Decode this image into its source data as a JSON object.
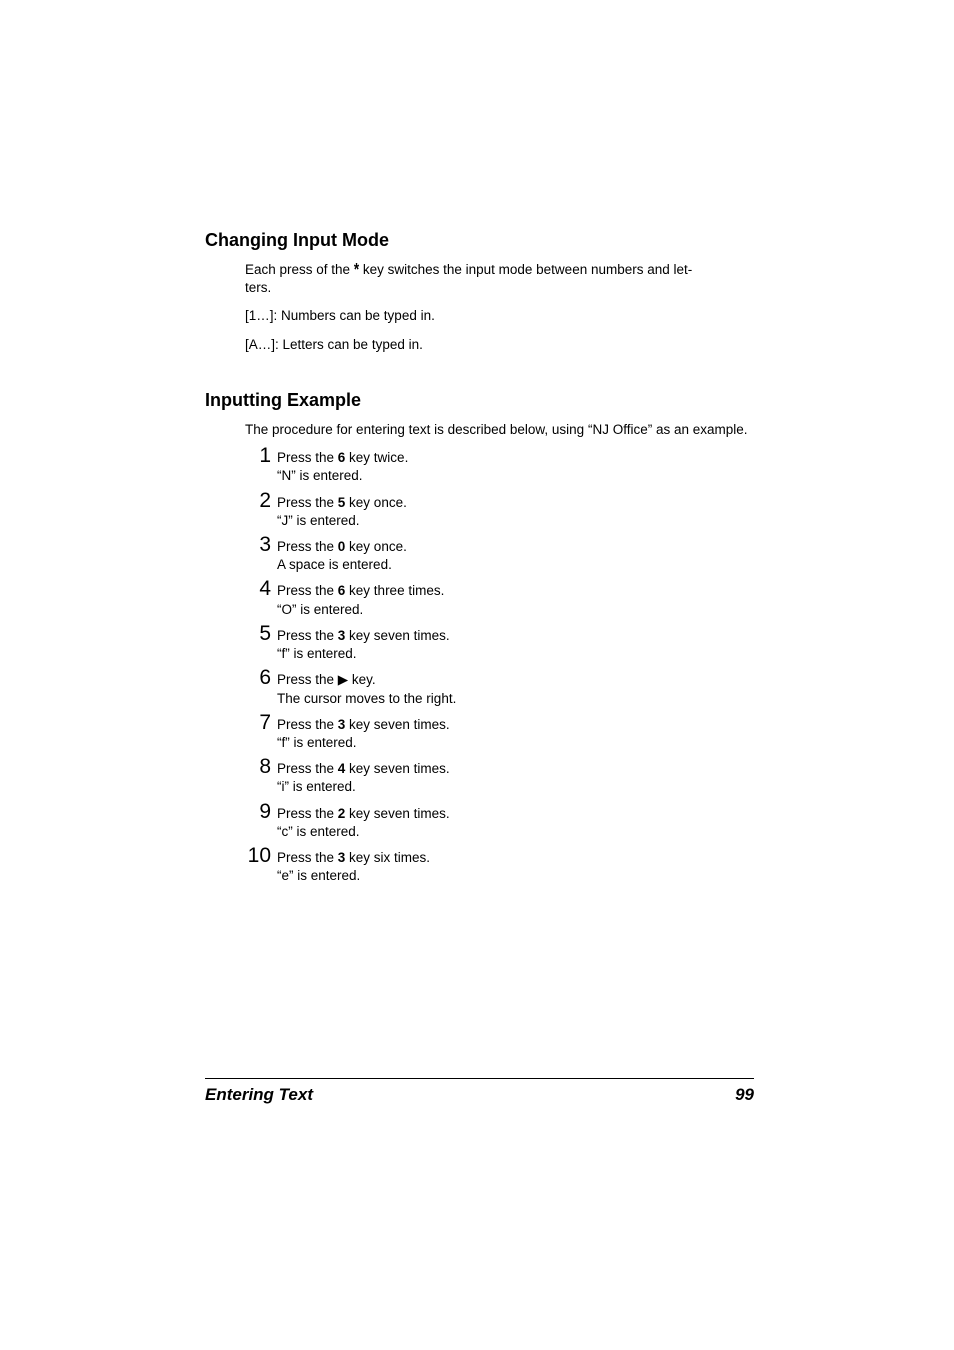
{
  "section1": {
    "heading": "Changing Input Mode",
    "p1_a": "Each press of the ",
    "star": "*",
    "p1_b": " key switches the input mode between numbers and let",
    "p1_c": "ters.",
    "p2": "[1…]: Numbers can be typed in.",
    "p3": "[A…]: Letters can be typed in."
  },
  "section2": {
    "heading": "Inputting Example",
    "intro": "The procedure for entering text is described below, using “NJ Office” as an example.",
    "steps": [
      {
        "n": "1",
        "l1a": "Press the ",
        "key": "6",
        "l1b": " key twice.",
        "l2": "“N” is entered."
      },
      {
        "n": "2",
        "l1a": "Press the ",
        "key": "5",
        "l1b": " key once.",
        "l2": "“J” is entered."
      },
      {
        "n": "3",
        "l1a": "Press the ",
        "key": "0",
        "l1b": " key once.",
        "l2": "A space is entered."
      },
      {
        "n": "4",
        "l1a": "Press the ",
        "key": "6",
        "l1b": " key three times.",
        "l2": "“O” is entered."
      },
      {
        "n": "5",
        "l1a": "Press the ",
        "key": "3",
        "l1b": " key seven times.",
        "l2": "“f” is entered."
      },
      {
        "n": "6",
        "l1a": "Press the ",
        "key": "▶",
        "l1b": " key.",
        "l2": "The cursor moves to the right."
      },
      {
        "n": "7",
        "l1a": "Press the ",
        "key": "3",
        "l1b": " key seven times.",
        "l2": "“f” is entered."
      },
      {
        "n": "8",
        "l1a": "Press the ",
        "key": "4",
        "l1b": " key seven times.",
        "l2": "“i” is entered."
      },
      {
        "n": "9",
        "l1a": "Press the ",
        "key": "2",
        "l1b": " key seven times.",
        "l2": "“c” is entered."
      },
      {
        "n": "10",
        "l1a": "Press the ",
        "key": "3",
        "l1b": " key six times.",
        "l2": "“e” is entered."
      }
    ]
  },
  "footer": {
    "title": "Entering Text",
    "page": "99"
  }
}
